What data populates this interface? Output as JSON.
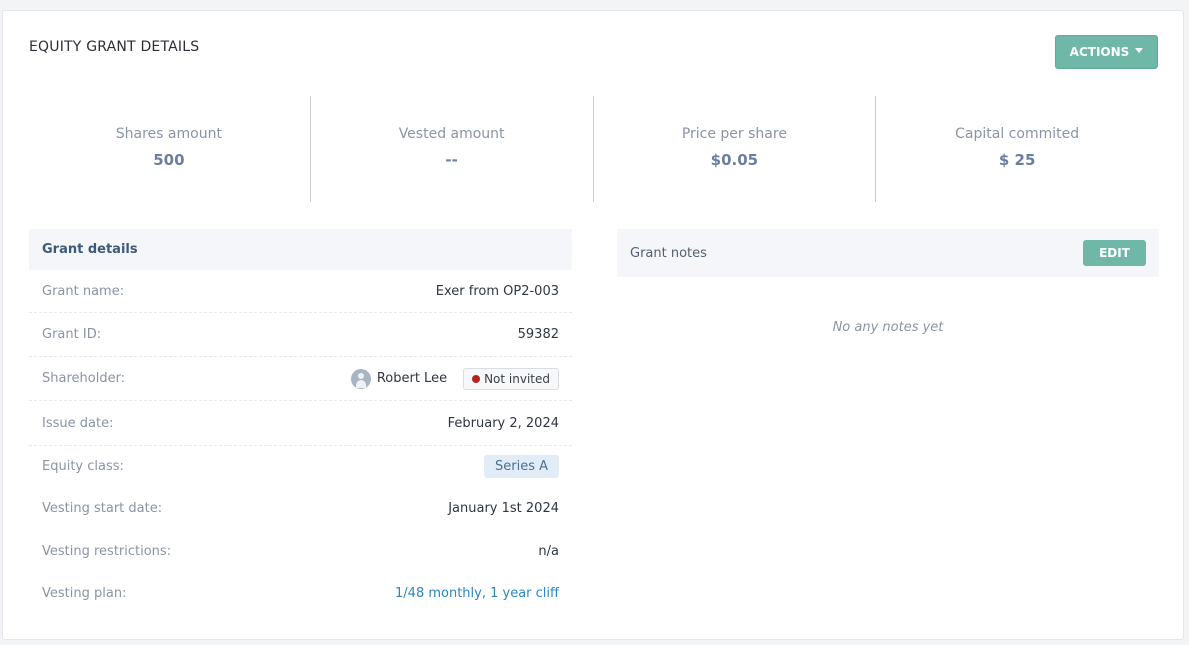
{
  "card": {
    "title": "EQUITY GRANT DETAILS",
    "actions_label": "ACTIONS"
  },
  "stats": [
    {
      "label": "Shares amount",
      "value": "500"
    },
    {
      "label": "Vested amount",
      "value": "--"
    },
    {
      "label": "Price per share",
      "value": "$0.05"
    },
    {
      "label": "Capital commited",
      "value": "$ 25"
    }
  ],
  "grant_details": {
    "title": "Grant details",
    "grant_name": {
      "label": "Grant name:",
      "value": "Exer from OP2-003"
    },
    "grant_id": {
      "label": "Grant ID:",
      "value": "59382"
    },
    "shareholder": {
      "label": "Shareholder:",
      "name": "Robert Lee",
      "status": "Not invited"
    },
    "issue_date": {
      "label": "Issue date:",
      "value": "February 2, 2024"
    },
    "equity_class": {
      "label": "Equity class:",
      "value": "Series A"
    },
    "vesting_start": {
      "label": "Vesting start date:",
      "value": "January 1st 2024"
    },
    "vesting_restrictions": {
      "label": "Vesting restrictions:",
      "value": "n/a"
    },
    "vesting_plan": {
      "label": "Vesting plan:",
      "value": "1/48 monthly, 1 year cliff"
    }
  },
  "notes": {
    "title": "Grant notes",
    "edit_label": "EDIT",
    "empty_text": "No any notes yet"
  },
  "colors": {
    "accent": "#6fb8a8",
    "link": "#2b86c5",
    "status_not_invited": "#b3231f"
  }
}
